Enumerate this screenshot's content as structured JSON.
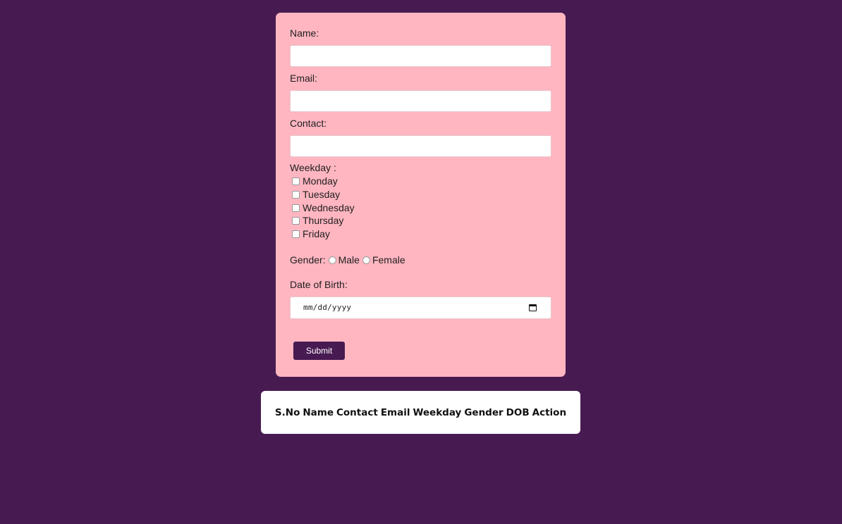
{
  "form": {
    "name_label": "Name:",
    "name_value": "",
    "email_label": "Email:",
    "email_value": "",
    "contact_label": "Contact:",
    "contact_value": "",
    "weekday_label": "Weekday :",
    "weekdays": [
      {
        "label": "Monday",
        "checked": false
      },
      {
        "label": "Tuesday",
        "checked": false
      },
      {
        "label": "Wednesday",
        "checked": false
      },
      {
        "label": "Thursday",
        "checked": false
      },
      {
        "label": "Friday",
        "checked": false
      }
    ],
    "gender_label": "Gender:",
    "gender_options": [
      {
        "label": "Male",
        "selected": false
      },
      {
        "label": "Female",
        "selected": false
      }
    ],
    "dob_label": "Date of Birth:",
    "dob_placeholder": "mm/dd/yyyy",
    "calendar_icon": "calendar-icon",
    "submit_label": "Submit"
  },
  "table": {
    "headers": [
      "S.No",
      "Name",
      "Contact",
      "Email",
      "Weekday",
      "Gender",
      "DOB",
      "Action"
    ]
  },
  "colors": {
    "background": "#481a52",
    "form_card": "#ffb6c1",
    "button": "#481a52",
    "table_card": "#ffffff"
  }
}
